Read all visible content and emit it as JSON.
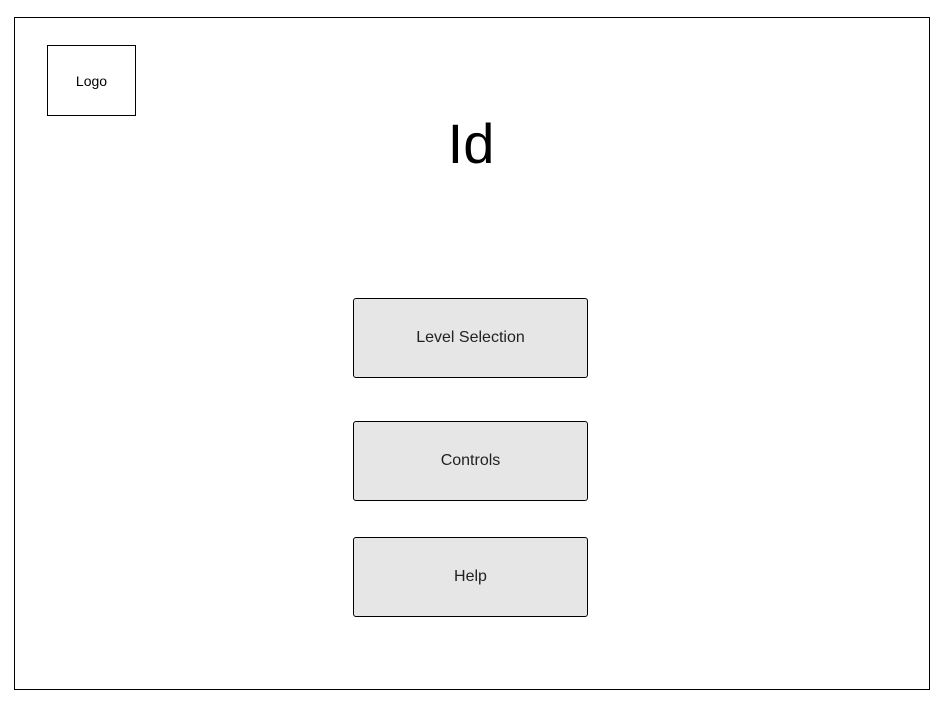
{
  "logo": {
    "label": "Logo"
  },
  "title": {
    "text": "Id"
  },
  "menu": {
    "items": [
      {
        "label": "Level Selection"
      },
      {
        "label": "Controls"
      },
      {
        "label": "Help"
      }
    ]
  },
  "colors": {
    "button_fill": "#e6e6e6",
    "border": "#000000",
    "background": "#ffffff"
  }
}
